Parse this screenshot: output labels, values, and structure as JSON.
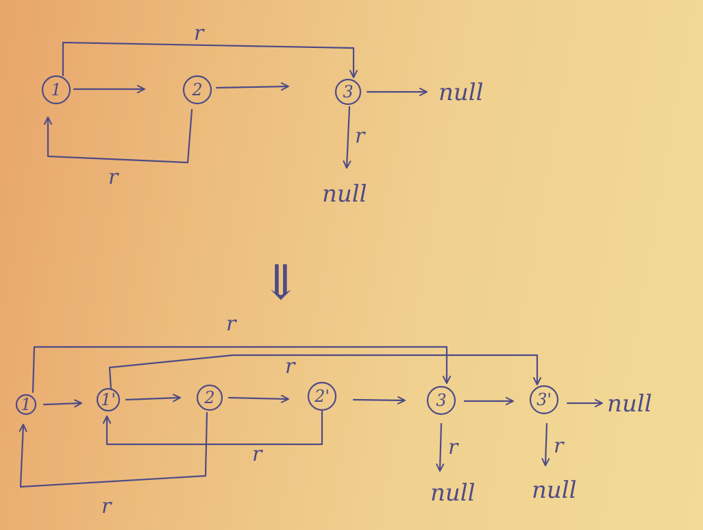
{
  "colors": {
    "ink": "#4e4a86",
    "paper_left": "#e8a56b",
    "paper_right": "#f2db97"
  },
  "top_diagram": {
    "nodes": [
      "1",
      "2",
      "3"
    ],
    "null_right": "null",
    "null_down": "null",
    "random_label": "r",
    "edges": [
      {
        "kind": "next",
        "from": "1",
        "to": "2"
      },
      {
        "kind": "next",
        "from": "2",
        "to": "3"
      },
      {
        "kind": "next",
        "from": "3",
        "to": "null"
      },
      {
        "kind": "random",
        "from": "1",
        "to": "3"
      },
      {
        "kind": "random",
        "from": "2",
        "to": "1"
      },
      {
        "kind": "random",
        "from": "3",
        "to": "null"
      }
    ]
  },
  "transform_arrow": "⇓",
  "bottom_diagram": {
    "nodes": [
      "1",
      "1'",
      "2",
      "2'",
      "3",
      "3'"
    ],
    "null_right": "null",
    "null_down_1": "null",
    "null_down_2": "null",
    "random_label": "r",
    "edges": [
      {
        "kind": "next",
        "from": "1",
        "to": "1'"
      },
      {
        "kind": "next",
        "from": "1'",
        "to": "2"
      },
      {
        "kind": "next",
        "from": "2",
        "to": "2'"
      },
      {
        "kind": "next",
        "from": "2'",
        "to": "3"
      },
      {
        "kind": "next",
        "from": "3",
        "to": "3'"
      },
      {
        "kind": "next",
        "from": "3'",
        "to": "null"
      },
      {
        "kind": "random",
        "from": "1",
        "to": "3"
      },
      {
        "kind": "random",
        "from": "1'",
        "to": "3'"
      },
      {
        "kind": "random",
        "from": "2'",
        "to": "1'"
      },
      {
        "kind": "random",
        "from": "2",
        "to": "1"
      },
      {
        "kind": "random",
        "from": "3",
        "to": "null"
      },
      {
        "kind": "random",
        "from": "3'",
        "to": "null"
      }
    ]
  }
}
